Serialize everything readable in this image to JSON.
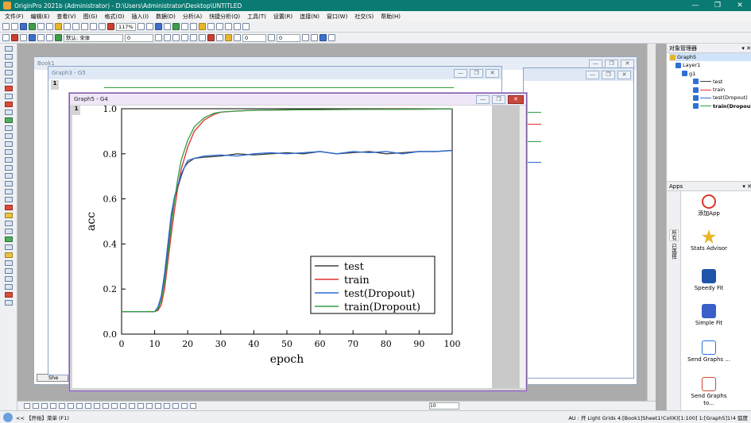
{
  "app": {
    "title": "OriginPro 2021b (Administrator) - D:\\Users\\Administrator\\Desktop\\UNTITLED",
    "window_controls": [
      "—",
      "❐",
      "✕"
    ]
  },
  "menu": [
    "文件(F)",
    "编辑(E)",
    "查看(V)",
    "图(G)",
    "格式(O)",
    "插入(I)",
    "数据(D)",
    "分析(A)",
    "快捷分析(Q)",
    "工具(T)",
    "设置(R)",
    "连接(N)",
    "窗口(W)",
    "社交(S)",
    "帮助(H)"
  ],
  "toolbar": {
    "zoom": "117%",
    "font_name": "默认: 宋体",
    "font_size": "0",
    "size_field_2": "0",
    "size_field_3": "0",
    "bottom_value": "10"
  },
  "windows": {
    "book1": {
      "title": "Book1",
      "sheet_tab": "She"
    },
    "graph3": {
      "title": "Graph3 - G5",
      "layer": "1"
    },
    "graph5": {
      "title": "Graph5 - G4",
      "layer": "1"
    }
  },
  "chart_data": {
    "type": "line",
    "xlabel": "epoch",
    "ylabel": "acc",
    "xlim": [
      0,
      100
    ],
    "ylim": [
      0,
      1
    ],
    "xticks": [
      "0",
      "10",
      "20",
      "30",
      "40",
      "50",
      "60",
      "70",
      "80",
      "90",
      "100"
    ],
    "yticks": [
      "0.0",
      "0.2",
      "0.4",
      "0.6",
      "0.8",
      "1.0"
    ],
    "legend_position": "lower-right",
    "series": [
      {
        "name": "test",
        "color": "#404040",
        "x": [
          0,
          5,
          10,
          11,
          12,
          13,
          14,
          15,
          16,
          17,
          18,
          19,
          20,
          22,
          25,
          30,
          35,
          40,
          45,
          50,
          55,
          60,
          65,
          70,
          75,
          80,
          85,
          90,
          95,
          100
        ],
        "y": [
          0.1,
          0.1,
          0.1,
          0.11,
          0.15,
          0.24,
          0.38,
          0.52,
          0.6,
          0.65,
          0.7,
          0.74,
          0.76,
          0.78,
          0.785,
          0.79,
          0.8,
          0.795,
          0.8,
          0.805,
          0.8,
          0.81,
          0.8,
          0.805,
          0.81,
          0.8,
          0.805,
          0.81,
          0.81,
          0.815
        ]
      },
      {
        "name": "train",
        "color": "#e03030",
        "x": [
          0,
          5,
          10,
          11,
          12,
          13,
          14,
          15,
          16,
          17,
          18,
          20,
          22,
          25,
          28,
          30,
          35,
          40,
          50,
          60,
          70,
          80,
          90,
          100
        ],
        "y": [
          0.1,
          0.1,
          0.1,
          0.105,
          0.13,
          0.2,
          0.32,
          0.44,
          0.55,
          0.65,
          0.73,
          0.83,
          0.9,
          0.95,
          0.975,
          0.985,
          0.99,
          0.993,
          0.995,
          0.996,
          0.997,
          0.998,
          0.998,
          0.999
        ]
      },
      {
        "name": "test(Dropout)",
        "color": "#2a6ad6",
        "x": [
          0,
          5,
          10,
          11,
          12,
          13,
          14,
          15,
          16,
          17,
          18,
          19,
          20,
          22,
          25,
          30,
          35,
          40,
          45,
          50,
          55,
          60,
          65,
          70,
          75,
          80,
          85,
          90,
          95,
          100
        ],
        "y": [
          0.1,
          0.1,
          0.1,
          0.12,
          0.17,
          0.27,
          0.4,
          0.53,
          0.61,
          0.66,
          0.71,
          0.74,
          0.77,
          0.78,
          0.79,
          0.795,
          0.79,
          0.8,
          0.805,
          0.8,
          0.805,
          0.81,
          0.8,
          0.81,
          0.805,
          0.81,
          0.8,
          0.81,
          0.81,
          0.815
        ]
      },
      {
        "name": "train(Dropout)",
        "color": "#2f9e44",
        "x": [
          0,
          5,
          10,
          11,
          12,
          13,
          14,
          15,
          16,
          17,
          18,
          20,
          22,
          25,
          28,
          30,
          35,
          40,
          50,
          60,
          70,
          80,
          90,
          100
        ],
        "y": [
          0.1,
          0.1,
          0.1,
          0.11,
          0.15,
          0.23,
          0.35,
          0.48,
          0.59,
          0.69,
          0.77,
          0.86,
          0.92,
          0.96,
          0.98,
          0.985,
          0.99,
          0.993,
          0.995,
          0.996,
          0.997,
          0.997,
          0.998,
          0.999
        ]
      }
    ]
  },
  "object_manager": {
    "title": "对象管理器",
    "items": [
      "Graph5",
      "Layer1",
      "g1",
      "test",
      "train",
      "test(Dropout)",
      "train(Dropout)"
    ]
  },
  "apps_panel": {
    "title": "Apps",
    "side_tabs": [
      "所有",
      "已选择"
    ],
    "items": [
      {
        "label": "添加App",
        "color": "#d9362b"
      },
      {
        "label": "Stats Advisor",
        "color": "#e7b52b"
      },
      {
        "label": "Speedy Fit",
        "color": "#1f55a8"
      },
      {
        "label": "Simple Fit",
        "color": "#3a5fc9"
      },
      {
        "label": "Send Graphs ...",
        "color": "#2f6fd6"
      },
      {
        "label": "Send Graphs to...",
        "color": "#c9483b"
      }
    ]
  },
  "status": {
    "left": "<< 【开始】菜单 (F1)",
    "right": "AU : 开  Light Grids  4:[Book1]Sheet1!Col(K)[1:100]  1:[Graph5]1!4  弧度"
  }
}
